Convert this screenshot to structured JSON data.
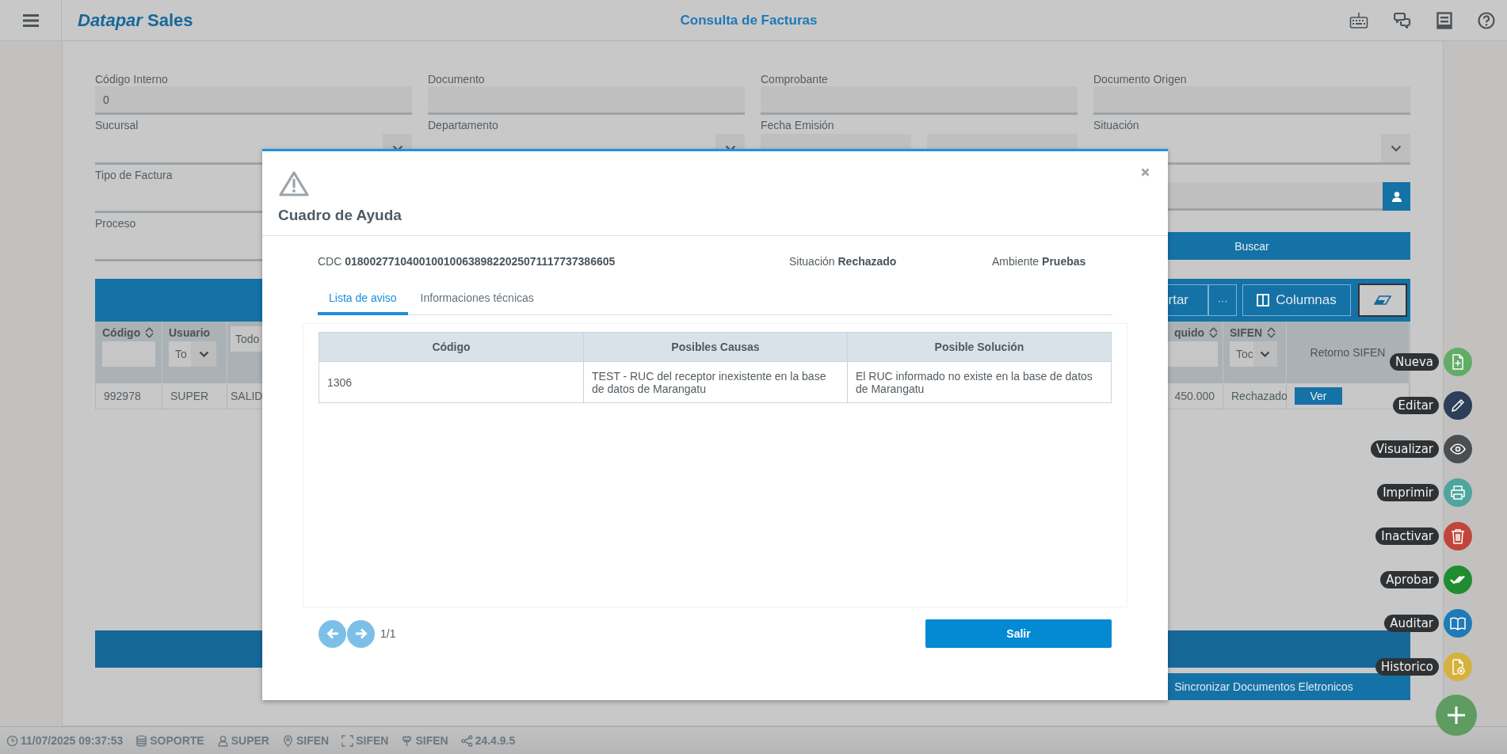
{
  "header": {
    "brand": "*Datapar* Sales",
    "title": "Consulta de Facturas"
  },
  "filters": [
    [
      {
        "kind": "text",
        "label": "Código Interno",
        "value": "0"
      },
      {
        "kind": "text",
        "label": "Documento"
      },
      {
        "kind": "text",
        "label": "Comprobante"
      },
      {
        "kind": "text",
        "label": "Documento Origen"
      }
    ],
    [
      {
        "kind": "select",
        "label": "Sucursal"
      },
      {
        "kind": "select",
        "label": "Departamento"
      },
      {
        "kind": "date_range",
        "label": "Fecha Emisión"
      },
      {
        "kind": "select",
        "label": "Situación"
      }
    ],
    [
      {
        "kind": "line",
        "label": "Tipo de Factura"
      },
      {
        "kind": "hidden"
      },
      {
        "kind": "hidden"
      },
      {
        "kind": "lookup"
      }
    ],
    [
      {
        "kind": "line",
        "label": "Proceso"
      },
      {
        "kind": "hidden"
      },
      {
        "kind": "hidden"
      },
      {
        "kind": "button",
        "label": "Buscar"
      }
    ]
  ],
  "toolbar": [
    {
      "kind": "export",
      "label": "rtar"
    },
    {
      "kind": "more",
      "label": "···"
    },
    {
      "kind": "columns",
      "label": "Columnas"
    },
    {
      "kind": "eraser"
    }
  ],
  "table": {
    "columns": [
      {
        "label": "Código",
        "sortable": true,
        "filter": {
          "kind": "input"
        }
      },
      {
        "label": "Usuario",
        "sortable": false,
        "filter": {
          "kind": "select",
          "value": "To"
        }
      },
      {
        "filter": {
          "kind": "input",
          "value": "Todo"
        }
      },
      {
        "label": "quido",
        "sortable": true,
        "filter": {
          "kind": "input"
        }
      },
      {
        "label": "SIFEN",
        "sortable": true,
        "filter": {
          "kind": "select",
          "value": "Toc"
        }
      },
      {
        "label": "Retorno SIFEN",
        "sortable": false
      }
    ],
    "rows": [
      {
        "cells": [
          "992978",
          "SUPER",
          "SALID",
          "450.000",
          "Rechazado"
        ],
        "action": "Ver"
      }
    ]
  },
  "sync_button": "Sincronizar Documentos Eletronicos",
  "modal": {
    "title": "Cuadro de Ayuda",
    "info": [
      {
        "label": "CDC",
        "value": "01800277104001001006389822025071117737386605"
      },
      {
        "label": "Situación",
        "value": "Rechazado"
      },
      {
        "label": "Ambiente",
        "value": "Pruebas"
      }
    ],
    "tabs": [
      {
        "label": "Lista de aviso",
        "selected": true
      },
      {
        "label": "Informaciones técnicas",
        "selected": false
      }
    ],
    "table": {
      "columns": [
        "Código",
        "Posibles Causas",
        "Posible Solución"
      ],
      "rows": [
        [
          "1306",
          "TEST - RUC del receptor inexistente en la base de datos de Marangatu",
          "El RUC informado no existe en la base de datos de Marangatu"
        ]
      ]
    },
    "page": "1/1",
    "exit": "Salir"
  },
  "actions": [
    {
      "label": "Nueva",
      "kind": "new",
      "color": "#62ad66"
    },
    {
      "label": "Editar",
      "kind": "edit",
      "color": "#2c3e58"
    },
    {
      "label": "Visualizar",
      "kind": "view",
      "color": "#4a4e51"
    },
    {
      "label": "Imprimir",
      "kind": "print",
      "color": "#4fa59c"
    },
    {
      "label": "Inactivar",
      "kind": "inactivate",
      "color": "#c2453b"
    },
    {
      "label": "Aprobar",
      "kind": "approve",
      "color": "#1f8c30"
    },
    {
      "label": "Auditar",
      "kind": "audit",
      "color": "#1f7bb6"
    },
    {
      "label": "Historico",
      "kind": "history",
      "color": "#d5b23e"
    }
  ],
  "status_bar": [
    {
      "kind": "clock",
      "text": "11/07/2025 09:37:53"
    },
    {
      "kind": "database",
      "text": "SOPORTE"
    },
    {
      "kind": "user",
      "text": "SUPER"
    },
    {
      "kind": "location",
      "text": "SIFEN"
    },
    {
      "kind": "frame",
      "text": "SIFEN"
    },
    {
      "kind": "plug",
      "text": "SIFEN"
    },
    {
      "kind": "network",
      "text": "24.4.9.5"
    }
  ]
}
